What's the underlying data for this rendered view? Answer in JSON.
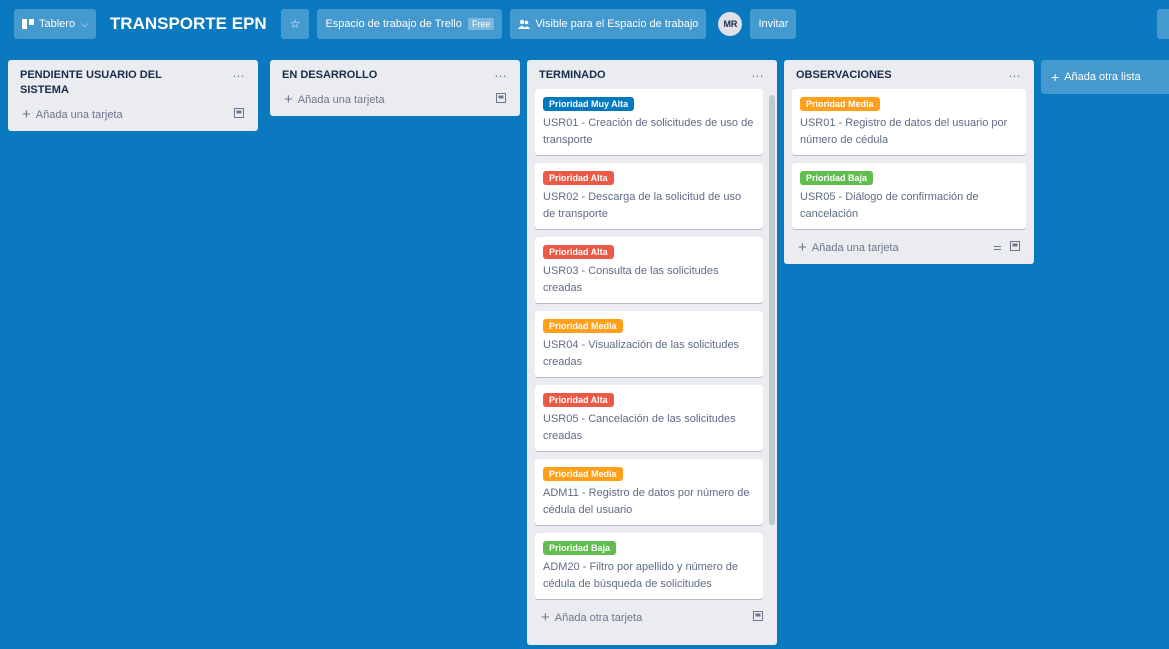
{
  "topbar": {
    "board_menu_label": "Tablero",
    "board_title": "TRANSPORTE EPN",
    "workspace_label": "Espacio de trabajo de Trello",
    "workspace_badge": "Free",
    "visibility_label": "Visible para el Espacio de trabajo",
    "avatar_initials": "MR",
    "invite_label": "Invitar"
  },
  "labels": {
    "muy_alta": {
      "text": "Prioridad Muy Alta",
      "color": "#0079bf"
    },
    "alta": {
      "text": "Prioridad Alta",
      "color": "#eb5a46"
    },
    "media": {
      "text": "Prioridad Media",
      "color": "#ff9f1a"
    },
    "baja": {
      "text": "Prioridad Baja",
      "color": "#61bd4f"
    }
  },
  "lists": [
    {
      "title": "PENDIENTE USUARIO DEL SISTEMA",
      "add_card_label": "Añada una tarjeta",
      "cards": []
    },
    {
      "title": "EN DESARROLLO",
      "add_card_label": "Añada una tarjeta",
      "cards": []
    },
    {
      "title": "TERMINADO",
      "add_card_label": "Añada otra tarjeta",
      "cards": [
        {
          "label": "Prioridad Muy Alta",
          "label_color": "#0079bf",
          "text": "USR01 - Creación de solicitudes de uso de transporte"
        },
        {
          "label": "Prioridad Alta",
          "label_color": "#eb5a46",
          "text": "USR02 - Descarga de la solicitud de uso de transporte"
        },
        {
          "label": "Prioridad Alta",
          "label_color": "#eb5a46",
          "text": "USR03 - Consulta de las solicitudes creadas"
        },
        {
          "label": "Prioridad Media",
          "label_color": "#ff9f1a",
          "text": "USR04 - Visualización de las solicitudes creadas"
        },
        {
          "label": "Prioridad Alta",
          "label_color": "#eb5a46",
          "text": "USR05 - Cancelación de las solicitudes creadas"
        },
        {
          "label": "Prioridad Media",
          "label_color": "#ff9f1a",
          "text": "ADM11 - Registro de datos por número de cédula del usuario"
        },
        {
          "label": "Prioridad Baja",
          "label_color": "#61bd4f",
          "text": "ADM20 - Filtro por apellido y número de cédula de búsqueda de solicitudes"
        }
      ]
    },
    {
      "title": "OBSERVACIONES",
      "add_card_label": "Añada una tarjeta",
      "cards": [
        {
          "label": "Prioridad Media",
          "label_color": "#ff9f1a",
          "text": "USR01 - Registro de datos del usuario por número de cédula"
        },
        {
          "label": "Prioridad Baja",
          "label_color": "#61bd4f",
          "text": "USR05 - Diálogo de confirmación de cancelación"
        }
      ]
    }
  ],
  "add_list_label": "Añada otra lista"
}
